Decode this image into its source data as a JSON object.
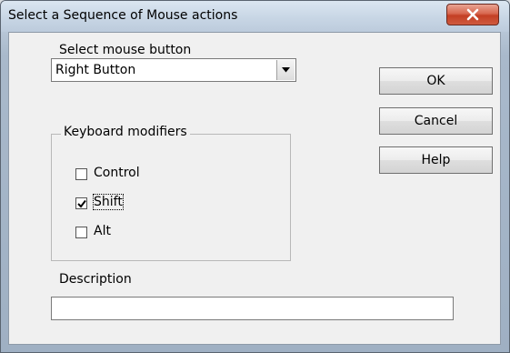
{
  "window": {
    "title": "Select a Sequence of Mouse actions"
  },
  "mouse_button": {
    "label": "Select mouse button",
    "selected": "Right Button"
  },
  "keyboard_modifiers": {
    "title": "Keyboard modifiers",
    "items": [
      {
        "label": "Control",
        "checked": false
      },
      {
        "label": "Shift",
        "checked": true
      },
      {
        "label": "Alt",
        "checked": false
      }
    ]
  },
  "description": {
    "label": "Description",
    "value": ""
  },
  "buttons": {
    "ok": "OK",
    "cancel": "Cancel",
    "help": "Help"
  },
  "icons": {
    "close": "close-icon",
    "dropdown": "chevron-down-icon",
    "check": "checkmark-icon"
  },
  "colors": {
    "close_button": "#c9462b",
    "dialog_background": "#f0f0f0"
  }
}
